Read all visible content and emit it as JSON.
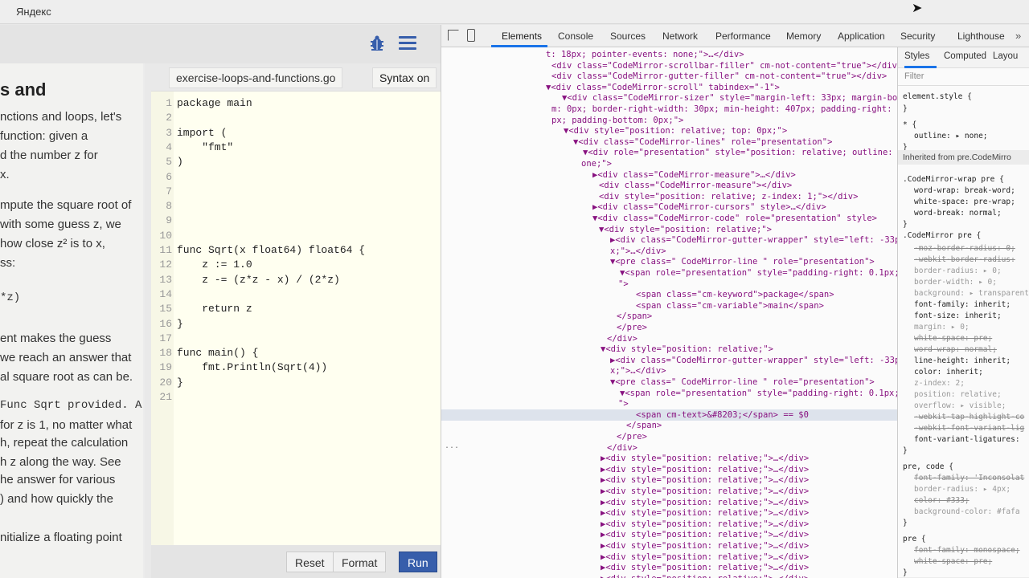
{
  "window": {
    "title": "Яндекс"
  },
  "tour": {
    "heading": "s and",
    "lesson_lines": [
      "nctions and loops, let's",
      " function: given a",
      "d the number z for",
      "x.",
      "",
      "mpute the square root of",
      "with some guess z, we",
      "how close z² is to x,",
      "ss:",
      "",
      "*z)",
      "",
      "ent makes the guess",
      "we reach an answer that",
      "al square root as can be.",
      "",
      "Func Sqrt provided. A",
      "for z is 1, no matter what",
      "h, repeat the calculation",
      "h z along the way. See",
      "he answer for various",
      ") and how quickly the",
      "",
      "nitialize a floating point"
    ],
    "file_tab": "exercise-loops-and-functions.go",
    "syntax_button": "Syntax on",
    "code_lines": [
      "package main",
      "",
      "import (",
      "    \"fmt\"",
      ")",
      "",
      "",
      "",
      "",
      "",
      "func Sqrt(x float64) float64 {",
      "    z := 1.0",
      "    z -= (z*z - x) / (2*z)",
      "",
      "    return z",
      "}",
      "",
      "func main() {",
      "    fmt.Println(Sqrt(4))",
      "}",
      ""
    ],
    "buttons": {
      "reset": "Reset",
      "format": "Format",
      "run": "Run"
    }
  },
  "devtools": {
    "tabs": [
      "Elements",
      "Console",
      "Sources",
      "Network",
      "Performance",
      "Memory",
      "Application",
      "Security",
      "Lighthouse"
    ],
    "more": "»",
    "dom_lines": [
      "t: 18px; pointer-events: none;\">…</div>",
      "<div class=\"CodeMirror-scrollbar-filler\" cm-not-content=\"true\"></div>",
      "<div class=\"CodeMirror-gutter-filler\" cm-not-content=\"true\"></div>",
      "▼<div class=\"CodeMirror-scroll\" tabindex=\"-1\">",
      "▼<div class=\"CodeMirror-sizer\" style=\"margin-left: 33px; margin-botto",
      "m: 0px; border-right-width: 30px; min-height: 407px; padding-right: 0",
      "px; padding-bottom: 0px;\">",
      "▼<div style=\"position: relative; top: 0px;\">",
      "▼<div class=\"CodeMirror-lines\" role=\"presentation\">",
      "▼<div role=\"presentation\" style=\"position: relative; outline: n",
      "one;\">",
      "▶<div class=\"CodeMirror-measure\">…</div>",
      "<div class=\"CodeMirror-measure\"></div>",
      "<div style=\"position: relative; z-index: 1;\"></div>",
      "▶<div class=\"CodeMirror-cursors\" style>…</div>",
      "▼<div class=\"CodeMirror-code\" role=\"presentation\" style>",
      "▼<div style=\"position: relative;\">",
      "▶<div class=\"CodeMirror-gutter-wrapper\" style=\"left: -33p",
      "x;\">…</div>",
      "▼<pre class=\" CodeMirror-line \" role=\"presentation\">",
      "▼<span role=\"presentation\" style=\"padding-right: 0.1px;",
      "\">",
      "<span class=\"cm-keyword\">package</span>",
      "<span class=\"cm-variable\">main</span>",
      "</span>",
      "</pre>",
      "</div>",
      "▼<div style=\"position: relative;\">",
      "▶<div class=\"CodeMirror-gutter-wrapper\" style=\"left: -33p",
      "x;\">…</div>",
      "▼<pre class=\" CodeMirror-line \" role=\"presentation\">",
      "▼<span role=\"presentation\" style=\"padding-right: 0.1px;",
      "\">",
      "<span cm-text>&#8203;</span> == $0",
      "</span>",
      "</pre>",
      "</div>",
      "▶<div style=\"position: relative;\">…</div>",
      "▶<div style=\"position: relative;\">…</div>",
      "▶<div style=\"position: relative;\">…</div>",
      "▶<div style=\"position: relative;\">…</div>",
      "▶<div style=\"position: relative;\">…</div>",
      "▶<div style=\"position: relative;\">…</div>",
      "▶<div style=\"position: relative;\">…</div>",
      "▶<div style=\"position: relative;\">…</div>",
      "▶<div style=\"position: relative;\">…</div>",
      "▶<div style=\"position: relative;\">…</div>",
      "▶<div style=\"position: relative;\">…</div>",
      "▶<div style=\"position: relative;\">…</div>"
    ],
    "dots": "...",
    "styles": {
      "tabs": [
        "Styles",
        "Computed",
        "Layou"
      ],
      "filter_placeholder": "Filter",
      "lines": [
        "element.style {",
        "}",
        "* {",
        "outline: ▸ none;",
        "}",
        "Inherited from pre.CodeMirro",
        ".CodeMirror-wrap pre {",
        "word-wrap: break-word;",
        "white-space: pre-wrap;",
        "word-break: normal;",
        "}",
        ".CodeMirror pre {",
        "-moz-border-radius: 0;",
        "-webkit-border-radius:",
        "border-radius: ▸ 0;",
        "border-width: ▸ 0;",
        "background: ▸ transparent",
        "font-family: inherit;",
        "font-size: inherit;",
        "margin: ▸ 0;",
        "white-space: pre;",
        "word-wrap: normal;",
        "line-height: inherit;",
        "color: inherit;",
        "z-index: 2;",
        "position: relative;",
        "overflow: ▸ visible;",
        "-webkit-tap-highlight-co",
        "-webkit-font-variant-lig",
        "font-variant-ligatures:",
        "}",
        "pre, code {",
        "font-family: 'Inconsolat",
        "border-radius: ▸ 4px;",
        "color: #333;",
        "background-color: #fafa",
        "}",
        "pre {",
        "font-family: monospace;",
        "white-space: pre;",
        "}",
        "Inherited from div.CodeMirror-"
      ]
    }
  }
}
